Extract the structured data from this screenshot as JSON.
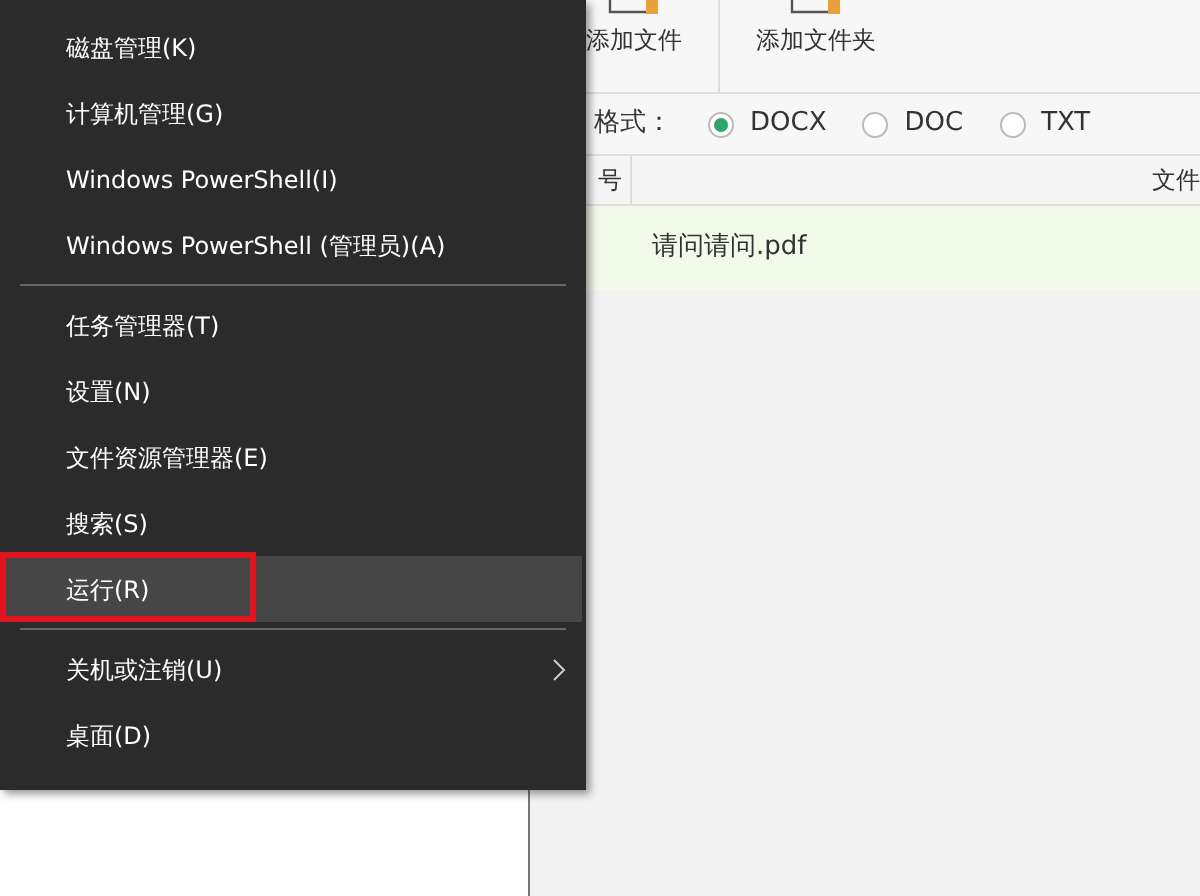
{
  "toolbar": {
    "buttons": [
      {
        "label": "添加文件"
      },
      {
        "label": "添加文件夹"
      }
    ]
  },
  "format": {
    "label": "格式：",
    "options": [
      {
        "label": "DOCX",
        "selected": true
      },
      {
        "label": "DOC",
        "selected": false
      },
      {
        "label": "TXT",
        "selected": false
      }
    ]
  },
  "table": {
    "columns": [
      "号",
      "文件"
    ],
    "rows": [
      {
        "name": "请问请问.pdf",
        "selected": true
      }
    ]
  },
  "menu": {
    "items": [
      {
        "kind": "item",
        "label": "磁盘管理(K)",
        "selected": false,
        "submenu": false
      },
      {
        "kind": "item",
        "label": "计算机管理(G)",
        "selected": false,
        "submenu": false
      },
      {
        "kind": "item",
        "label": "Windows PowerShell(I)",
        "selected": false,
        "submenu": false
      },
      {
        "kind": "item",
        "label": "Windows PowerShell (管理员)(A)",
        "selected": false,
        "submenu": false
      },
      {
        "kind": "separator"
      },
      {
        "kind": "item",
        "label": "任务管理器(T)",
        "selected": false,
        "submenu": false
      },
      {
        "kind": "item",
        "label": "设置(N)",
        "selected": false,
        "submenu": false
      },
      {
        "kind": "item",
        "label": "文件资源管理器(E)",
        "selected": false,
        "submenu": false
      },
      {
        "kind": "item",
        "label": "搜索(S)",
        "selected": false,
        "submenu": false
      },
      {
        "kind": "item",
        "label": "运行(R)",
        "selected": true,
        "submenu": false
      },
      {
        "kind": "separator"
      },
      {
        "kind": "item",
        "label": "关机或注销(U)",
        "selected": false,
        "submenu": true
      },
      {
        "kind": "item",
        "label": "桌面(D)",
        "selected": false,
        "submenu": false
      }
    ]
  }
}
